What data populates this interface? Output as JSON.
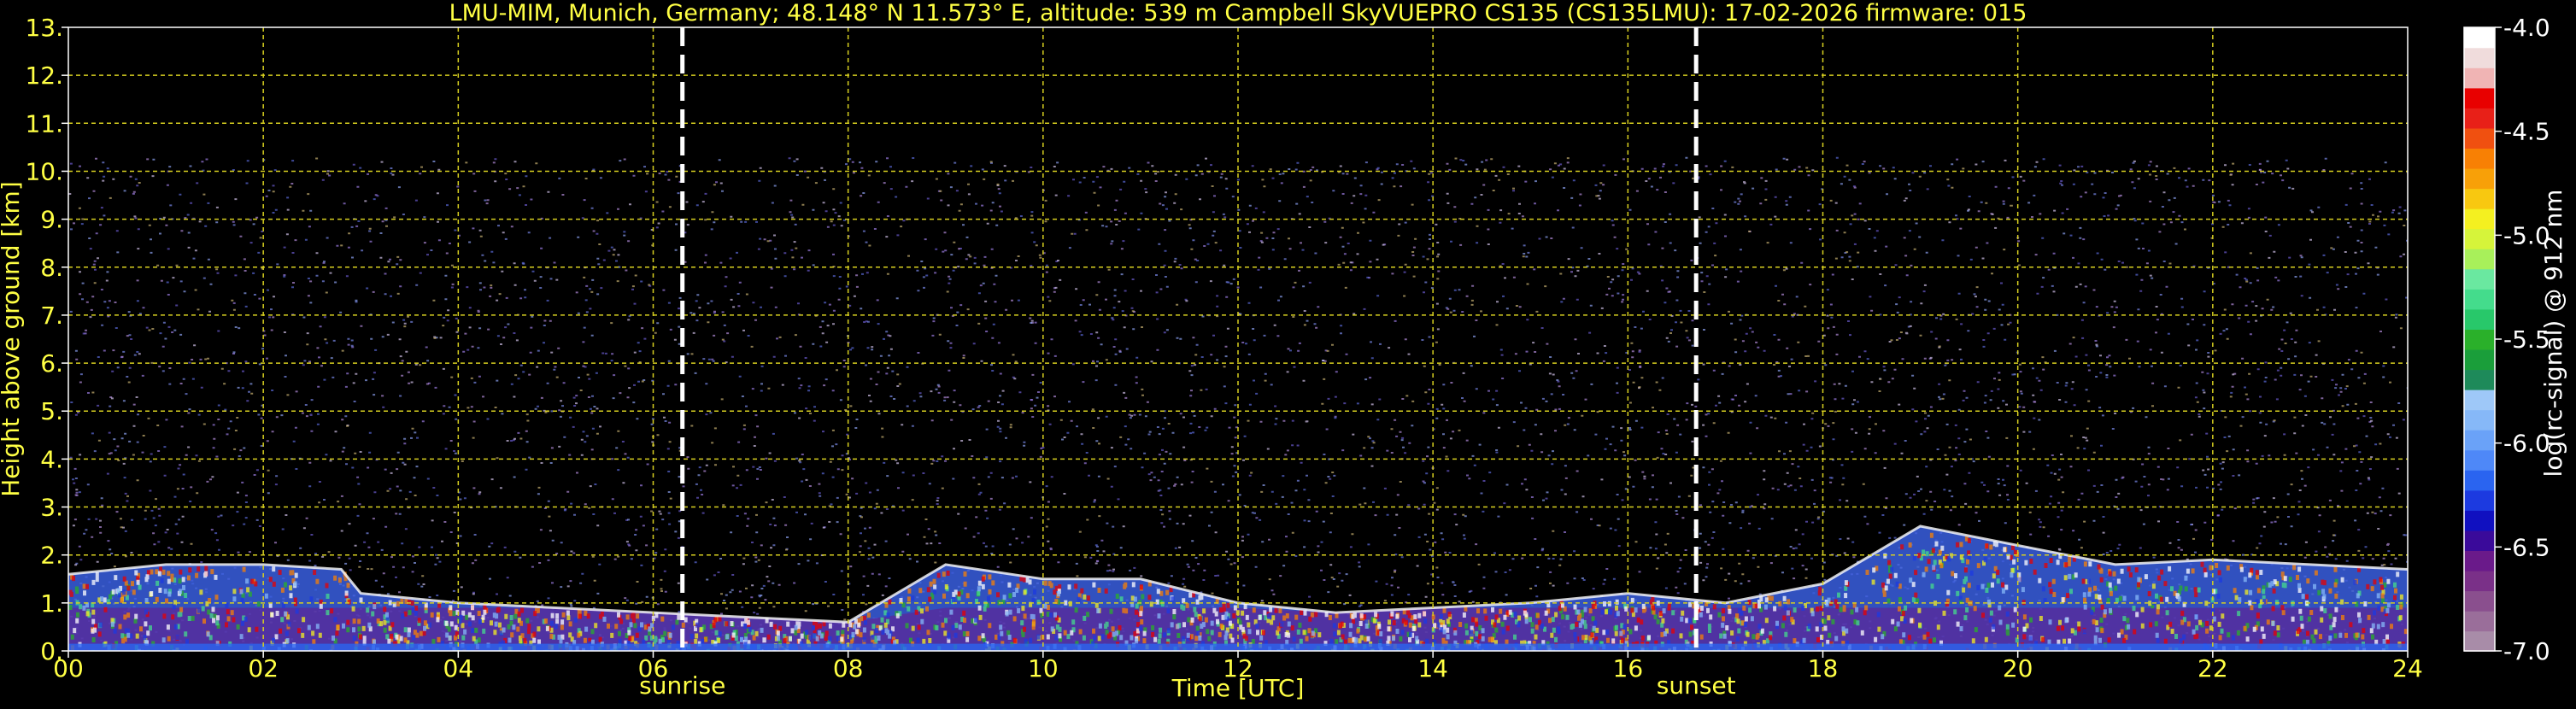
{
  "chart_data": {
    "type": "heatmap",
    "title": "LMU-MIM, Munich, Germany; 48.148° N 11.573° E, altitude: 539 m    Campbell SkyVUEPRO CS135 (CS135LMU): 17-02-2026    firmware: 015",
    "xlabel": "Time [UTC]",
    "ylabel": "Height above ground [km]",
    "xlim": [
      0,
      24
    ],
    "ylim": [
      0,
      13
    ],
    "x_ticks": [
      "00",
      "02",
      "04",
      "06",
      "08",
      "10",
      "12",
      "14",
      "16",
      "18",
      "20",
      "22",
      "24"
    ],
    "y_ticks": [
      "0.",
      "1.",
      "2.",
      "3.",
      "4.",
      "5.",
      "6.",
      "7.",
      "8.",
      "9.",
      "10.",
      "11.",
      "12.",
      "13."
    ],
    "grid": true,
    "markers": [
      {
        "label": "sunrise",
        "x": 6.3
      },
      {
        "label": "sunset",
        "x": 16.7
      }
    ],
    "colorbar": {
      "label": "log(rc-signal) @ 912 nm",
      "range": [
        -7.0,
        -4.0
      ],
      "ticks": [
        "-4.0",
        "-4.5",
        "-5.0",
        "-5.5",
        "-6.0",
        "-6.5",
        "-7.0"
      ],
      "colors": [
        "#a88ca8",
        "#9a6e9a",
        "#8a4f8e",
        "#7a3088",
        "#6a1a8a",
        "#3a0a9a",
        "#1010c0",
        "#1c3ae0",
        "#2a64f0",
        "#4e88f8",
        "#6aa2f8",
        "#86b8f8",
        "#9ec8f8",
        "#1e8a5a",
        "#1a9e3a",
        "#2ab02a",
        "#28c86a",
        "#44dc8c",
        "#6ae8a0",
        "#a8f05a",
        "#d6f43a",
        "#f4f020",
        "#f8c810",
        "#f8a008",
        "#f88004",
        "#f05010",
        "#e82018",
        "#e80000",
        "#f0b4b4",
        "#f0dcdc",
        "#ffffff"
      ]
    },
    "boundary_layer": {
      "x": [
        0,
        1,
        2,
        2.8,
        3,
        4,
        5,
        6,
        7,
        8,
        9,
        10,
        11,
        12,
        13,
        14,
        15,
        16,
        17,
        18,
        19,
        20,
        21,
        22,
        23,
        24
      ],
      "height": [
        1.6,
        1.8,
        1.8,
        1.7,
        1.2,
        1.0,
        0.9,
        0.8,
        0.7,
        0.6,
        1.8,
        1.5,
        1.5,
        1.0,
        0.8,
        0.9,
        1.0,
        1.2,
        1.0,
        1.4,
        2.6,
        2.2,
        1.8,
        1.9,
        1.8,
        1.7
      ]
    },
    "noise_top_km": 10.3
  }
}
